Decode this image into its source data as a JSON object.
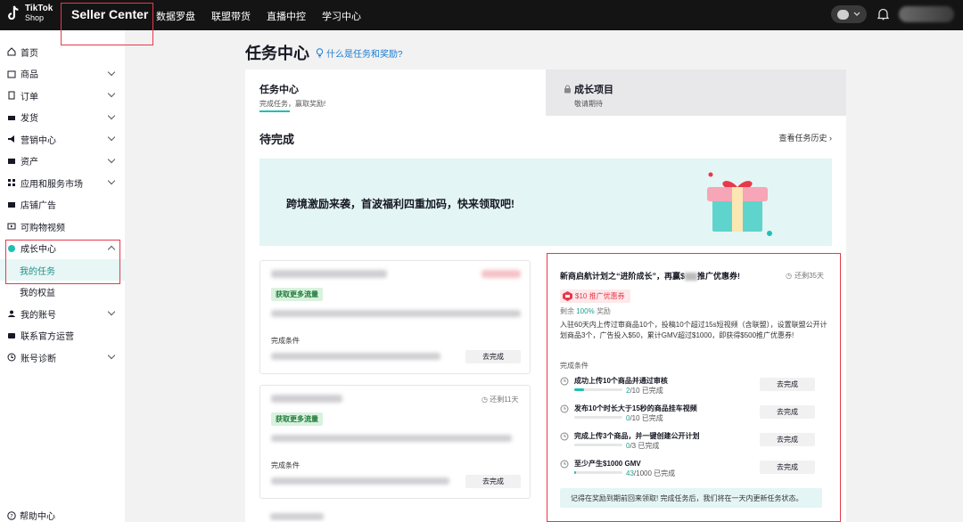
{
  "topbar": {
    "logo_line1": "TikTok",
    "logo_line2": "Shop",
    "app_title": "Seller Center",
    "nav": [
      "数据罗盘",
      "联盟带货",
      "直播中控",
      "学习中心"
    ],
    "icons": [
      "chat-icon",
      "bell-icon",
      "avatar"
    ]
  },
  "sidebar": {
    "items": [
      {
        "label": "首页",
        "icon": "home-icon",
        "chevron": false
      },
      {
        "label": "商品",
        "icon": "product-icon",
        "chevron": true
      },
      {
        "label": "订单",
        "icon": "order-icon",
        "chevron": true
      },
      {
        "label": "发货",
        "icon": "shipping-icon",
        "chevron": true
      },
      {
        "label": "营销中心",
        "icon": "marketing-icon",
        "chevron": true
      },
      {
        "label": "资产",
        "icon": "assets-icon",
        "chevron": true
      },
      {
        "label": "应用和服务市场",
        "icon": "apps-icon",
        "chevron": true
      },
      {
        "label": "店铺广告",
        "icon": "ads-icon",
        "chevron": false
      },
      {
        "label": "可购物视频",
        "icon": "video-icon",
        "chevron": false
      },
      {
        "label": "成长中心",
        "icon": "growth-icon",
        "chevron": "up"
      }
    ],
    "sub_items": [
      {
        "label": "我的任务",
        "active": true
      },
      {
        "label": "我的权益",
        "active": false
      }
    ],
    "items_after": [
      {
        "label": "我的账号",
        "icon": "account-icon",
        "chevron": true
      },
      {
        "label": "联系官方运营",
        "icon": "contact-icon",
        "chevron": false
      },
      {
        "label": "账号诊断",
        "icon": "diagnose-icon",
        "chevron": true
      }
    ],
    "help_center": "帮助中心"
  },
  "main": {
    "page_title": "任务中心",
    "help_link": "什么是任务和奖励?",
    "tabs": [
      {
        "title": "任务中心",
        "sub": "完成任务，赢取奖励!",
        "active": true
      },
      {
        "title": "成长项目",
        "sub": "敬请期待",
        "active": false
      }
    ],
    "pending_title": "待完成",
    "history_link": "查看任务历史",
    "banner_text": "跨境激励来袭，首波福利四重加码，快来领取吧!",
    "left_cards": [
      {
        "tag": "获取更多流量",
        "cond_label": "完成条件",
        "button": "去完成",
        "remain": ""
      },
      {
        "tag": "获取更多流量",
        "cond_label": "完成条件",
        "button": "去完成",
        "remain": "还剩11天"
      }
    ],
    "featured": {
      "title_pre": "新商启航计划之“进阶成长”，再赢$",
      "title_post": "推广优惠券!",
      "remain": "还剩35天",
      "coupon": "$10 推广优惠券",
      "remain_label": "剩余",
      "remain_pct": "100%",
      "remain_suffix": "奖励",
      "description": "入驻60天内上传过审商品10个，投稿10个超过15s短视频（含联盟），设置联盟公开计划商品3个，广告投入$50，累计GMV超过$1000，即获得$500推广优惠券!",
      "cond_label": "完成条件",
      "tasks": [
        {
          "name": "成功上传10个商品并通过审核",
          "done": "2",
          "total": "/10 已完成",
          "fraction": 0.2,
          "button": "去完成"
        },
        {
          "name": "发布10个时长大于15秒的商品挂车视频",
          "done": "0",
          "total": "/10 已完成",
          "fraction": 0.0,
          "button": "去完成"
        },
        {
          "name": "完成上传3个商品，并一键创建公开计划",
          "done": "0",
          "total": "/3 已完成",
          "fraction": 0.0,
          "button": "去完成"
        },
        {
          "name": "至少产生$1000 GMV",
          "done": "43",
          "total": "/1000 已完成",
          "fraction": 0.043,
          "button": "去完成"
        }
      ],
      "notice": "记得在奖励到期前回来领取! 完成任务后，我们将在一天内更新任务状态。"
    }
  },
  "colors": {
    "accent": "#1fbfb5",
    "highlight_border": "#e8384a",
    "topbar": "#141414"
  }
}
